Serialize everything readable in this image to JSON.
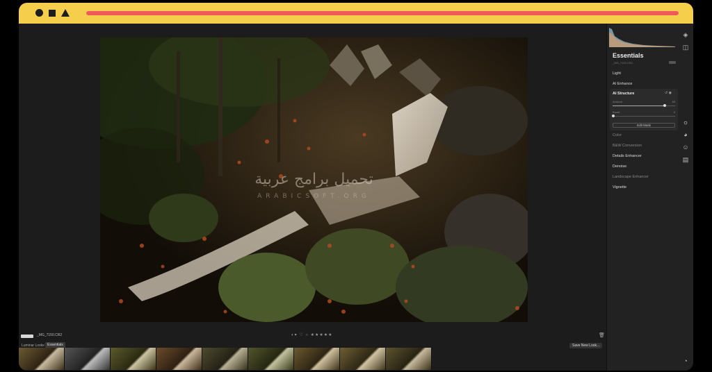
{
  "browser": {
    "shapes": [
      "circle",
      "square",
      "triangle"
    ],
    "accent_bar_color": "#f0595b",
    "frame_color": "#f5cf4c"
  },
  "viewer": {
    "file_name": "_MG_7150.CR2",
    "toolbar_glyphs": "◐▾ ♡ ○ ★★★★★",
    "trash_icon": "trash-icon"
  },
  "watermark": {
    "arabic": "تحميل برامج عربية",
    "latin": "ARABICSOFT.ORG"
  },
  "looks": {
    "label": "Luminar Looks",
    "active_tab": "Essentials",
    "save_button": "Save New Look..."
  },
  "panel": {
    "title": "Essentials",
    "subtitle": "_MG_7150.CR2",
    "tools": [
      {
        "label": "Light",
        "dim": false
      },
      {
        "label": "AI Enhance",
        "dim": false
      },
      {
        "label": "Color",
        "dim": true
      },
      {
        "label": "B&W Conversion",
        "dim": true
      },
      {
        "label": "Details Enhancer",
        "dim": false
      },
      {
        "label": "Denoise",
        "dim": false
      },
      {
        "label": "Landscape Enhancer",
        "dim": true
      },
      {
        "label": "Vignette",
        "dim": false
      }
    ],
    "ai_structure": {
      "title": "AI Structure",
      "amount_label": "Amount",
      "amount_value": "83",
      "amount_fraction": 0.83,
      "boost_label": "Boost",
      "boost_value": "0",
      "boost_fraction": 0.0,
      "edit_mask": "Edit Mask"
    }
  },
  "side_icons": [
    "layers-icon",
    "compare-icon",
    "sun-icon",
    "palette-icon",
    "face-icon",
    "grid-icon",
    "history-icon"
  ]
}
